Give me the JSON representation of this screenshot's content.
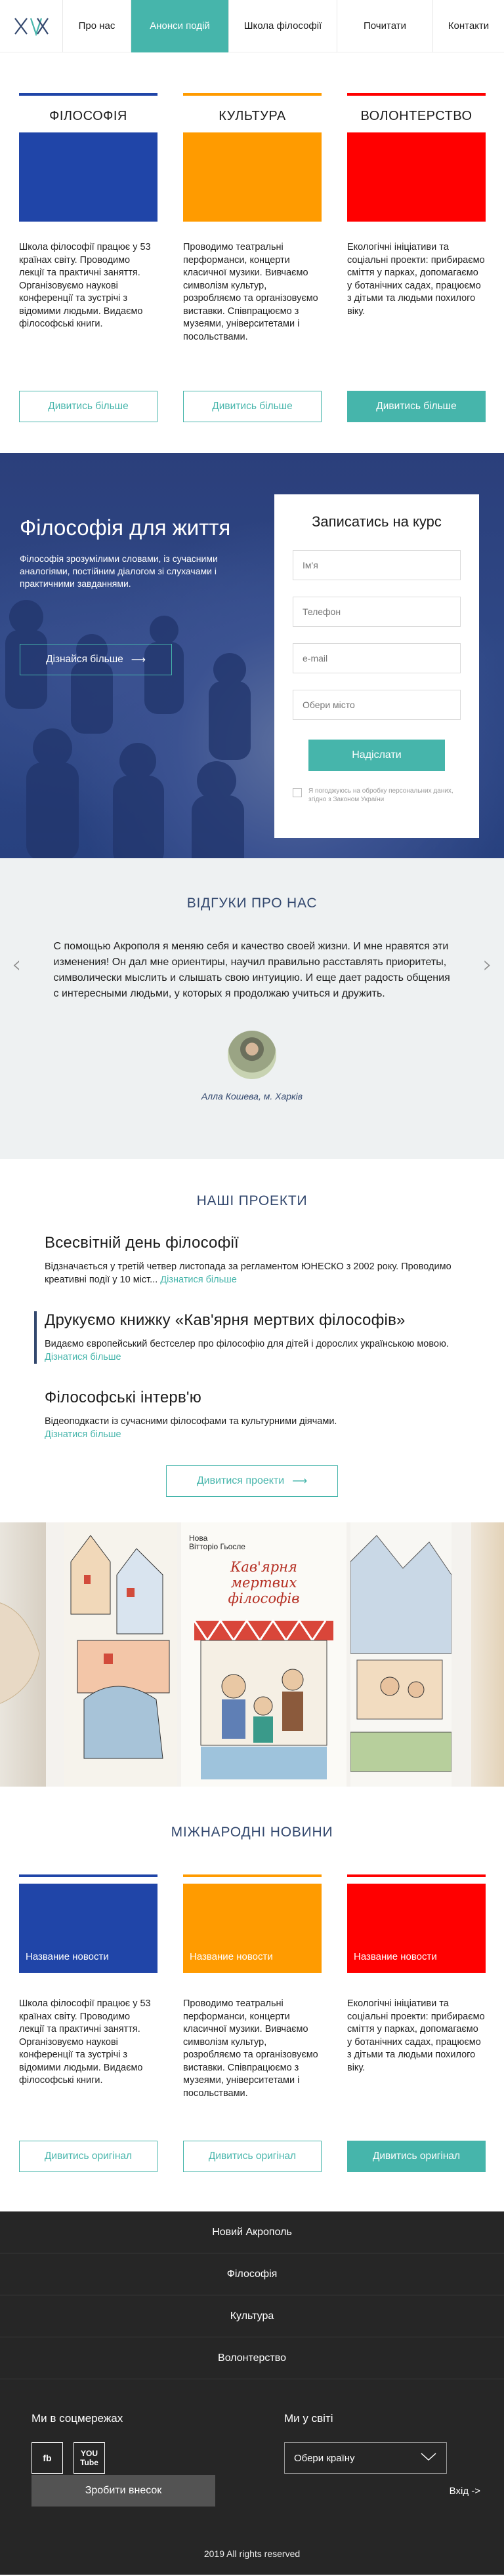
{
  "nav": {
    "items": [
      {
        "label": "Про нас",
        "active": false
      },
      {
        "label": "Анонси подій",
        "active": true
      },
      {
        "label": "Школа філософії",
        "active": false
      },
      {
        "label": "Почитати",
        "active": false
      },
      {
        "label": "Контакти",
        "active": false
      }
    ]
  },
  "colors": {
    "accent": "#46b5ab",
    "blue": "#2045a8",
    "orange": "#ff9b00",
    "red": "#ff0000",
    "dark": "#262626",
    "navy": "#33486e"
  },
  "cards": [
    {
      "title": "ФІЛОСОФІЯ",
      "color": "#2045a8",
      "text": "Школа філософії працює у 53 країнах світу. Проводимо лекції та практичні заняття. Організовуємо наукові конференції та зустрічі з відомими людьми. Видаємо філософські книги.",
      "button": "Дивитись більше"
    },
    {
      "title": "КУЛЬТУРА",
      "color": "#ff9b00",
      "text": "Проводимо театральні перформанси, концерти класичної музики. Вивчаємо символізм культур, розробляємо та організовуємо виставки. Співпрацюємо з музеями, університетами і посольствами.",
      "button": "Дивитись більше"
    },
    {
      "title": "ВОЛОНТЕРСТВО",
      "color": "#ff0000",
      "text": "Екологічні ініціативи та соціальні проекти: прибираємо сміття у парках, допомагаємо у ботанічних садах, працюємо з дітьми та людьми похилого віку.",
      "button": "Дивитись більше"
    }
  ],
  "hero": {
    "title": "Філософія для життя",
    "subtitle": "Філософія зрозумілими словами, із сучасними аналогіями, постійним діалогом зі слухачами і практичними завданнями.",
    "button": "Дізнайся більше"
  },
  "form": {
    "title": "Записатись на курс",
    "placeholders": [
      "Ім'я",
      "Телефон",
      "e-mail",
      "Обери місто"
    ],
    "submit": "Надіслати",
    "agree": "Я погоджуюсь на обробку персональних даних, згідно з Законом України"
  },
  "reviews": {
    "title": "ВІДГУКИ ПРО НАС",
    "text": "С помощью Акрополя я меняю себя и качество своей жизни. И мне нравятся эти изменения! Он дал мне ориентиры, научил правильно расставлять приоритеты, символически мыслить и слышать свою интуицию. И еще дает радость общения с интересными людьми, у которых я продолжаю учиться и дружить.",
    "author": "Алла Кошева, м. Харків"
  },
  "projects": {
    "title": "НАШІ ПРОЕКТИ",
    "items": [
      {
        "title": "Всесвітній день філософії",
        "text": "Відзначається у третій четвер листопада за регламентом ЮНЕСКО з 2002 року. Проводимо креативні події у 10 міст...",
        "more": "Дізнатися більше"
      },
      {
        "title": "Друкуємо книжку «Кав'ярня мертвих філософів»",
        "text": "Видаємо європейський бестселер про філософію для дітей і дорослих українською мовою.",
        "more": "Дізнатися більше"
      },
      {
        "title": "Філософські інтерв'ю",
        "text": "Відеоподкасти із сучасними філософами та культурними діячами.",
        "more": "Дізнатися більше"
      }
    ],
    "button": "Дивитися проекти"
  },
  "gallery": {
    "book_author": "Нова\nВітторіо Гьосле",
    "book_title": "Кав'ярня мертвих філософів"
  },
  "news": {
    "title": "МІЖНАРОДНІ НОВИНИ",
    "cards": [
      {
        "label": "Название новости",
        "color": "#2045a8",
        "text": "Школа філософії працює у 53 країнах світу. Проводимо лекції та практичні заняття. Організовуємо наукові конференції та зустрічі з відомими людьми. Видаємо філософські книги.",
        "button": "Дивитись оригінал"
      },
      {
        "label": "Название новости",
        "color": "#ff9b00",
        "text": "Проводимо театральні перформанси, концерти класичної музики. Вивчаємо символізм культур, розробляємо та організовуємо виставки. Співпрацюємо з музеями, університетами і посольствами.",
        "button": "Дивитись оригінал"
      },
      {
        "label": "Название новости",
        "color": "#ff0000",
        "text": "Екологічні ініціативи та соціальні проекти: прибираємо сміття у парках, допомагаємо у ботанічних садах, працюємо з дітьми та людьми похилого віку.",
        "button": "Дивитись оригінал"
      }
    ]
  },
  "footer": {
    "menu": [
      "Новий Акрополь",
      "Філософія",
      "Культура",
      "Волонтерство"
    ],
    "social_title": "Ми в соцмережах",
    "social": [
      "fb",
      "YOU Tube"
    ],
    "world_title": "Ми у світі",
    "country_select": "Обери країну",
    "donate": "Зробити внесок",
    "login": "Вхід ->",
    "copyright": "2019 All rights reserved"
  }
}
